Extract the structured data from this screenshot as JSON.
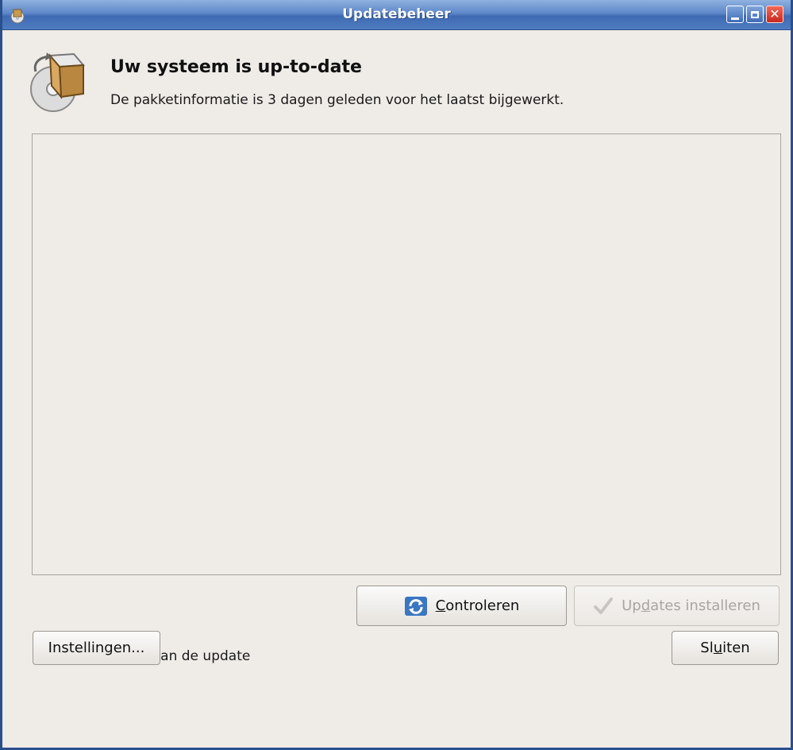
{
  "window": {
    "title": "Updatebeheer"
  },
  "header": {
    "title": "Uw systeem is up-to-date",
    "subtitle": "De pakketinformatie is 3 dagen geleden voor het laatst bijgewerkt."
  },
  "actions": {
    "check_pre": "",
    "check_mnemonic": "C",
    "check_post": "ontroleren",
    "install_pre": "Up",
    "install_mnemonic": "d",
    "install_post": "ates installeren"
  },
  "details": {
    "expander_label": "Omschrijving van de update"
  },
  "footer": {
    "settings_label": "Instellingen...",
    "close_pre": "Sl",
    "close_mnemonic": "u",
    "close_post": "iten"
  },
  "icons": {
    "app": "package-update-icon",
    "refresh": "refresh-icon",
    "install": "checkmark-icon",
    "expander": "triangle-right-icon"
  },
  "colors": {
    "titlebar": "#4f7cc0",
    "close_button": "#c9261b",
    "window_bg": "#efebe7"
  }
}
